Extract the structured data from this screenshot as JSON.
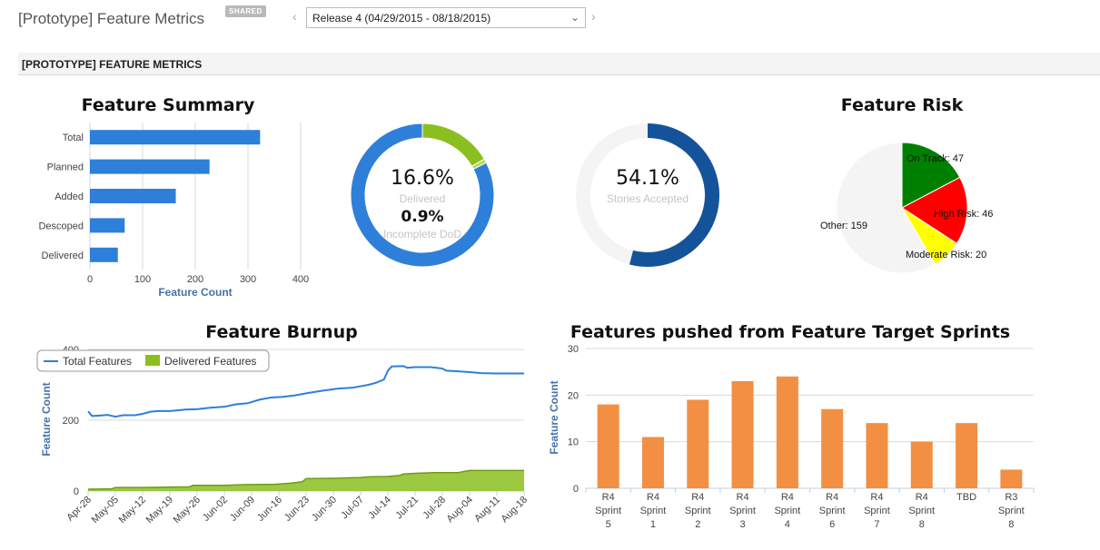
{
  "header": {
    "title": "[Prototype] Feature Metrics",
    "badge": "SHARED",
    "release_select": "Release 4 (04/29/2015 - 08/18/2015)",
    "prev_arrow": "‹",
    "next_arrow": "›"
  },
  "section": {
    "title": "[PROTOTYPE] FEATURE METRICS"
  },
  "colors": {
    "bar_blue": "#2e7fd9",
    "delivered_green": "#8bbf20",
    "dark_blue": "#14539a",
    "orange": "#f28f43",
    "risk_green": "#008000",
    "risk_red": "#ff0000",
    "risk_yellow": "#ffff00",
    "other_gray": "#f4f4f4"
  },
  "chart_data": [
    {
      "type": "bar",
      "orientation": "horizontal",
      "title": "Feature Summary",
      "categories": [
        "Total",
        "Planned",
        "Added",
        "Descoped",
        "Delivered"
      ],
      "values": [
        323,
        227,
        163,
        66,
        53
      ],
      "xlabel": "Feature Count",
      "xlim": [
        0,
        400
      ],
      "xticks": [
        0,
        100,
        200,
        300,
        400
      ]
    },
    {
      "type": "pie",
      "variant": "donut",
      "slices": [
        {
          "name": "Delivered",
          "value": 16.6,
          "color": "#8bbf20"
        },
        {
          "name": "Incomplete DoD",
          "value": 0.9,
          "color": "#b6d957"
        },
        {
          "name": "Remaining",
          "value": 82.5,
          "color": "#2e7fd9"
        }
      ],
      "labels": {
        "pct1": "16.6%",
        "label1": "Delivered",
        "pct2": "0.9%",
        "label2": "Incomplete DoD"
      }
    },
    {
      "type": "pie",
      "variant": "donut",
      "slices": [
        {
          "name": "Stories Accepted",
          "value": 54.1,
          "color": "#14539a"
        },
        {
          "name": "Remaining",
          "value": 45.9,
          "color": "#f4f4f4"
        }
      ],
      "labels": {
        "pct1": "54.1%",
        "label1": "Stories Accepted"
      }
    },
    {
      "type": "pie",
      "title": "Feature Risk",
      "slices": [
        {
          "name": "On Track",
          "value": 47,
          "label": "On Track: 47",
          "color": "#008000"
        },
        {
          "name": "High Risk",
          "value": 46,
          "label": "High Risk: 46",
          "color": "#ff0000"
        },
        {
          "name": "Moderate Risk",
          "value": 20,
          "label": "Moderate Risk: 20",
          "color": "#ffff00"
        },
        {
          "name": "Other",
          "value": 159,
          "label": "Other: 159",
          "color": "#f4f4f4"
        }
      ]
    },
    {
      "type": "area",
      "title": "Feature Burnup",
      "ylabel": "Feature Count",
      "ylim": [
        0,
        400
      ],
      "yticks": [
        0,
        200,
        400
      ],
      "xlim": [
        0,
        112
      ],
      "xtick_labels": [
        "Apr-28",
        "May-05",
        "May-12",
        "May-19",
        "May-26",
        "Jun-02",
        "Jun-09",
        "Jun-16",
        "Jun-23",
        "Jun-30",
        "Jul-07",
        "Jul-14",
        "Jul-21",
        "Jul-28",
        "Aug-04",
        "Aug-11",
        "Aug-18"
      ],
      "xtick_positions": [
        0,
        7,
        14,
        21,
        28,
        35,
        42,
        49,
        56,
        63,
        70,
        77,
        84,
        91,
        98,
        105,
        112
      ],
      "legend": [
        "Total Features",
        "Delivered Features"
      ],
      "series": [
        {
          "name": "Total Features",
          "type": "line",
          "color": "#2e7fd9",
          "points": [
            [
              0,
              225
            ],
            [
              1,
              212
            ],
            [
              3,
              213
            ],
            [
              5,
              215
            ],
            [
              7,
              210
            ],
            [
              9,
              214
            ],
            [
              12,
              214
            ],
            [
              14,
              218
            ],
            [
              16,
              224
            ],
            [
              18,
              226
            ],
            [
              21,
              226
            ],
            [
              23,
              228
            ],
            [
              25,
              230
            ],
            [
              28,
              231
            ],
            [
              31,
              235
            ],
            [
              35,
              238
            ],
            [
              38,
              245
            ],
            [
              41,
              248
            ],
            [
              44,
              258
            ],
            [
              47,
              264
            ],
            [
              50,
              266
            ],
            [
              53,
              270
            ],
            [
              56,
              276
            ],
            [
              60,
              283
            ],
            [
              64,
              289
            ],
            [
              68,
              292
            ],
            [
              70,
              296
            ],
            [
              72,
              300
            ],
            [
              74,
              306
            ],
            [
              76,
              315
            ],
            [
              77,
              340
            ],
            [
              78,
              352
            ],
            [
              81,
              353
            ],
            [
              82,
              348
            ],
            [
              84,
              350
            ],
            [
              88,
              350
            ],
            [
              91,
              346
            ],
            [
              92,
              340
            ],
            [
              95,
              338
            ],
            [
              98,
              336
            ],
            [
              101,
              333
            ],
            [
              105,
              332
            ],
            [
              112,
              332
            ]
          ]
        },
        {
          "name": "Delivered Features",
          "type": "area",
          "color": "#8bbf20",
          "points": [
            [
              0,
              5
            ],
            [
              6,
              6
            ],
            [
              7,
              10
            ],
            [
              14,
              10
            ],
            [
              20,
              11
            ],
            [
              26,
              12
            ],
            [
              27,
              16
            ],
            [
              35,
              16
            ],
            [
              40,
              18
            ],
            [
              48,
              19
            ],
            [
              52,
              22
            ],
            [
              55,
              26
            ],
            [
              56,
              35
            ],
            [
              63,
              36
            ],
            [
              70,
              38
            ],
            [
              72,
              40
            ],
            [
              77,
              41
            ],
            [
              80,
              44
            ],
            [
              81,
              48
            ],
            [
              84,
              50
            ],
            [
              89,
              52
            ],
            [
              95,
              52
            ],
            [
              98,
              58
            ],
            [
              112,
              58
            ]
          ]
        }
      ]
    },
    {
      "type": "bar",
      "title": "Features pushed from Feature Target Sprints",
      "ylabel": "Feature Count",
      "ylim": [
        0,
        30
      ],
      "yticks": [
        0,
        10,
        20,
        30
      ],
      "categories": [
        "R4 Sprint 5",
        "R4 Sprint 1",
        "R4 Sprint 2",
        "R4 Sprint 3",
        "R4 Sprint 4",
        "R4 Sprint 6",
        "R4 Sprint 7",
        "R4 Sprint 8",
        "TBD",
        "R3 Sprint 8"
      ],
      "category_lines": [
        [
          "R4",
          "Sprint",
          "5"
        ],
        [
          "R4",
          "Sprint",
          "1"
        ],
        [
          "R4",
          "Sprint",
          "2"
        ],
        [
          "R4",
          "Sprint",
          "3"
        ],
        [
          "R4",
          "Sprint",
          "4"
        ],
        [
          "R4",
          "Sprint",
          "6"
        ],
        [
          "R4",
          "Sprint",
          "7"
        ],
        [
          "R4",
          "Sprint",
          "8"
        ],
        [
          "TBD"
        ],
        [
          "R3",
          "Sprint",
          "8"
        ]
      ],
      "values": [
        18,
        11,
        19,
        23,
        24,
        17,
        14,
        10,
        14,
        4
      ]
    }
  ]
}
